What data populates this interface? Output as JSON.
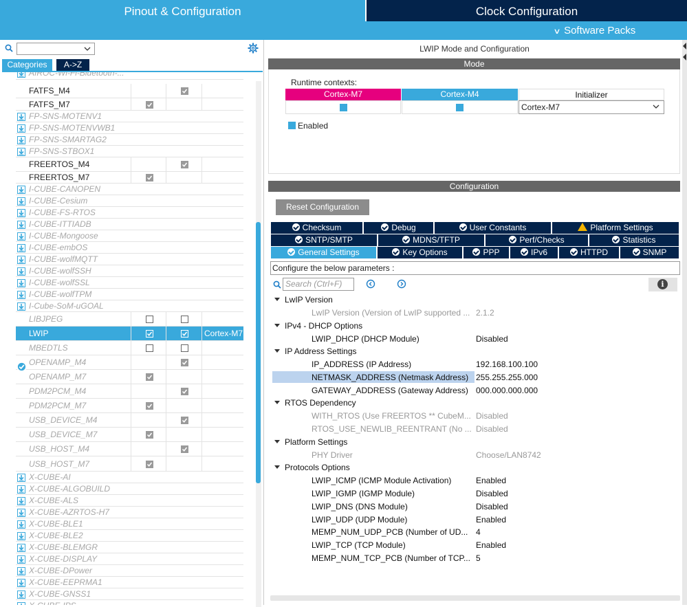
{
  "tabs": {
    "pinout": "Pinout & Configuration",
    "clock": "Clock Configuration"
  },
  "software_packs": "Software Packs",
  "left": {
    "category_tab": "Categories",
    "az_tab": "A->Z",
    "rows": [
      {
        "name": "AIROC-Wi-Fi-Bluetooth-...",
        "type": "pack"
      },
      {
        "name": "FATFS_M4",
        "type": "plain",
        "c1": "",
        "c2": "on"
      },
      {
        "name": "FATFS_M7",
        "type": "plain",
        "c1": "on",
        "c2": ""
      },
      {
        "name": "FP-SNS-MOTENV1",
        "type": "pack"
      },
      {
        "name": "FP-SNS-MOTENVWB1",
        "type": "pack"
      },
      {
        "name": "FP-SNS-SMARTAG2",
        "type": "pack"
      },
      {
        "name": "FP-SNS-STBOX1",
        "type": "pack"
      },
      {
        "name": "FREERTOS_M4",
        "type": "plain",
        "c1": "",
        "c2": "on"
      },
      {
        "name": "FREERTOS_M7",
        "type": "plain",
        "c1": "on",
        "c2": ""
      },
      {
        "name": "I-CUBE-CANOPEN",
        "type": "pack"
      },
      {
        "name": "I-CUBE-Cesium",
        "type": "pack"
      },
      {
        "name": "I-CUBE-FS-RTOS",
        "type": "pack"
      },
      {
        "name": "I-CUBE-ITTIADB",
        "type": "pack"
      },
      {
        "name": "I-CUBE-Mongoose",
        "type": "pack"
      },
      {
        "name": "I-CUBE-embOS",
        "type": "pack"
      },
      {
        "name": "I-CUBE-wolfMQTT",
        "type": "pack"
      },
      {
        "name": "I-CUBE-wolfSSH",
        "type": "pack"
      },
      {
        "name": "I-CUBE-wolfSSL",
        "type": "pack"
      },
      {
        "name": "I-CUBE-wolfTPM",
        "type": "pack"
      },
      {
        "name": "I-Cube-SoM-uGOAL",
        "type": "pack"
      },
      {
        "name": "LIBJPEG",
        "type": "gray",
        "c1": "off",
        "c2": "off"
      },
      {
        "name": "LWIP",
        "type": "sel",
        "c1": "onw",
        "c2": "onw",
        "ctx": "Cortex-M7"
      },
      {
        "name": "MBEDTLS",
        "type": "gray",
        "c1": "off",
        "c2": "off"
      },
      {
        "name": "OPENAMP_M4",
        "type": "gray",
        "c1": "",
        "c2": "on"
      },
      {
        "name": "OPENAMP_M7",
        "type": "gray",
        "c1": "on",
        "c2": ""
      },
      {
        "name": "PDM2PCM_M4",
        "type": "gray",
        "c1": "",
        "c2": "on"
      },
      {
        "name": "PDM2PCM_M7",
        "type": "gray",
        "c1": "on",
        "c2": ""
      },
      {
        "name": "USB_DEVICE_M4",
        "type": "gray",
        "c1": "",
        "c2": "on"
      },
      {
        "name": "USB_DEVICE_M7",
        "type": "gray",
        "c1": "on",
        "c2": ""
      },
      {
        "name": "USB_HOST_M4",
        "type": "gray",
        "c1": "",
        "c2": "on"
      },
      {
        "name": "USB_HOST_M7",
        "type": "gray",
        "c1": "on",
        "c2": ""
      },
      {
        "name": "X-CUBE-AI",
        "type": "pack"
      },
      {
        "name": "X-CUBE-ALGOBUILD",
        "type": "pack"
      },
      {
        "name": "X-CUBE-ALS",
        "type": "pack"
      },
      {
        "name": "X-CUBE-AZRTOS-H7",
        "type": "pack"
      },
      {
        "name": "X-CUBE-BLE1",
        "type": "pack"
      },
      {
        "name": "X-CUBE-BLE2",
        "type": "pack"
      },
      {
        "name": "X-CUBE-BLEMGR",
        "type": "pack"
      },
      {
        "name": "X-CUBE-DISPLAY",
        "type": "pack"
      },
      {
        "name": "X-CUBE-DPower",
        "type": "pack"
      },
      {
        "name": "X-CUBE-EEPRMA1",
        "type": "pack"
      },
      {
        "name": "X-CUBE-GNSS1",
        "type": "pack"
      },
      {
        "name": "X-CUBE-IPS",
        "type": "pack"
      }
    ]
  },
  "right": {
    "title": "LWIP Mode and Configuration",
    "mode_header": "Mode",
    "runtime_label": "Runtime contexts:",
    "ctx_m7": "Cortex-M7",
    "ctx_m4": "Cortex-M4",
    "initializer": "Initializer",
    "initializer_value": "Cortex-M7",
    "enabled_label": "Enabled",
    "config_header": "Configuration",
    "reset_label": "Reset Configuration",
    "tabs_row1": [
      {
        "label": "Checksum",
        "icon": "ok"
      },
      {
        "label": "Debug",
        "icon": "ok"
      },
      {
        "label": "User Constants",
        "icon": "ok"
      },
      {
        "label": "Platform Settings",
        "icon": "warn"
      }
    ],
    "tabs_row2": [
      {
        "label": "SNTP/SMTP",
        "icon": "ok"
      },
      {
        "label": "MDNS/TFTP",
        "icon": "ok"
      },
      {
        "label": "Perf/Checks",
        "icon": "ok"
      },
      {
        "label": "Statistics",
        "icon": "ok"
      }
    ],
    "tabs_row3": [
      {
        "label": "General Settings",
        "icon": "ok",
        "active": true
      },
      {
        "label": "Key Options",
        "icon": "ok"
      },
      {
        "label": "PPP",
        "icon": "ok"
      },
      {
        "label": "IPv6",
        "icon": "ok"
      },
      {
        "label": "HTTPD",
        "icon": "ok"
      },
      {
        "label": "SNMP",
        "icon": "ok"
      }
    ],
    "prompt": "Configure the below parameters :",
    "search_placeholder": "Search (Ctrl+F)",
    "groups": [
      {
        "title": "LwIP Version",
        "params": [
          {
            "name": "LwIP Version (Version of LwIP supported ...",
            "value": "2.1.2",
            "dim": true
          }
        ]
      },
      {
        "title": "IPv4 - DHCP Options",
        "params": [
          {
            "name": "LWIP_DHCP (DHCP Module)",
            "value": "Disabled"
          }
        ]
      },
      {
        "title": "IP Address Settings",
        "params": [
          {
            "name": "IP_ADDRESS (IP Address)",
            "value": "192.168.100.100"
          },
          {
            "name": "NETMASK_ADDRESS (Netmask Address)",
            "value": "255.255.255.000",
            "highlight": true
          },
          {
            "name": "GATEWAY_ADDRESS (Gateway Address)",
            "value": "000.000.000.000"
          }
        ]
      },
      {
        "title": "RTOS Dependency",
        "params": [
          {
            "name": "WITH_RTOS (Use FREERTOS ** CubeM...",
            "value": "Disabled",
            "dim": true
          },
          {
            "name": "RTOS_USE_NEWLIB_REENTRANT (No ...",
            "value": "Disabled",
            "dim": true
          }
        ]
      },
      {
        "title": "Platform Settings",
        "params": [
          {
            "name": "PHY Driver",
            "value": "Choose/LAN8742",
            "dim": true
          }
        ]
      },
      {
        "title": "Protocols Options",
        "params": [
          {
            "name": "LWIP_ICMP (ICMP Module Activation)",
            "value": "Enabled"
          },
          {
            "name": "LWIP_IGMP (IGMP Module)",
            "value": "Disabled"
          },
          {
            "name": "LWIP_DNS (DNS Module)",
            "value": "Disabled"
          },
          {
            "name": "LWIP_UDP (UDP Module)",
            "value": "Enabled"
          },
          {
            "name": "MEMP_NUM_UDP_PCB (Number of UD...",
            "value": "4"
          },
          {
            "name": "LWIP_TCP (TCP Module)",
            "value": "Enabled"
          },
          {
            "name": "MEMP_NUM_TCP_PCB (Number of TCP...",
            "value": "5"
          }
        ]
      }
    ]
  },
  "colors": {
    "accent": "#39a9dc",
    "navy": "#03234b",
    "m7": "#e6007e",
    "selection": "#bcd3ee"
  }
}
